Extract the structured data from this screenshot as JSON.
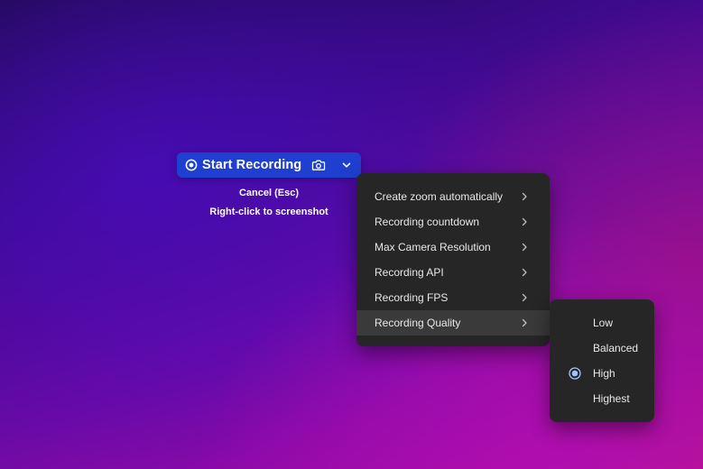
{
  "toolbar": {
    "start_label": "Start Recording",
    "start_icon": "record-icon",
    "camera_icon": "camera-icon",
    "dropdown_icon": "chevron-down-icon",
    "background_color": "#1f3fd0"
  },
  "hints": {
    "cancel": "Cancel (Esc)",
    "screenshot": "Right-click to screenshot"
  },
  "menu": {
    "items": [
      {
        "label": "Create zoom automatically"
      },
      {
        "label": "Recording countdown"
      },
      {
        "label": "Max Camera Resolution"
      },
      {
        "label": "Recording API"
      },
      {
        "label": "Recording FPS"
      },
      {
        "label": "Recording Quality",
        "active": true
      }
    ],
    "submenu_icon": "chevron-right-icon"
  },
  "quality_submenu": {
    "options": [
      {
        "label": "Low",
        "selected": false
      },
      {
        "label": "Balanced",
        "selected": false
      },
      {
        "label": "High",
        "selected": true
      },
      {
        "label": "Highest",
        "selected": false
      }
    ],
    "selected_icon": "radio-selected-icon"
  },
  "colors": {
    "menu_bg": "#262626",
    "menu_active_bg": "#3a3a3a",
    "menu_text": "#e8e8e8",
    "radio_accent": "#9fc3ff"
  }
}
